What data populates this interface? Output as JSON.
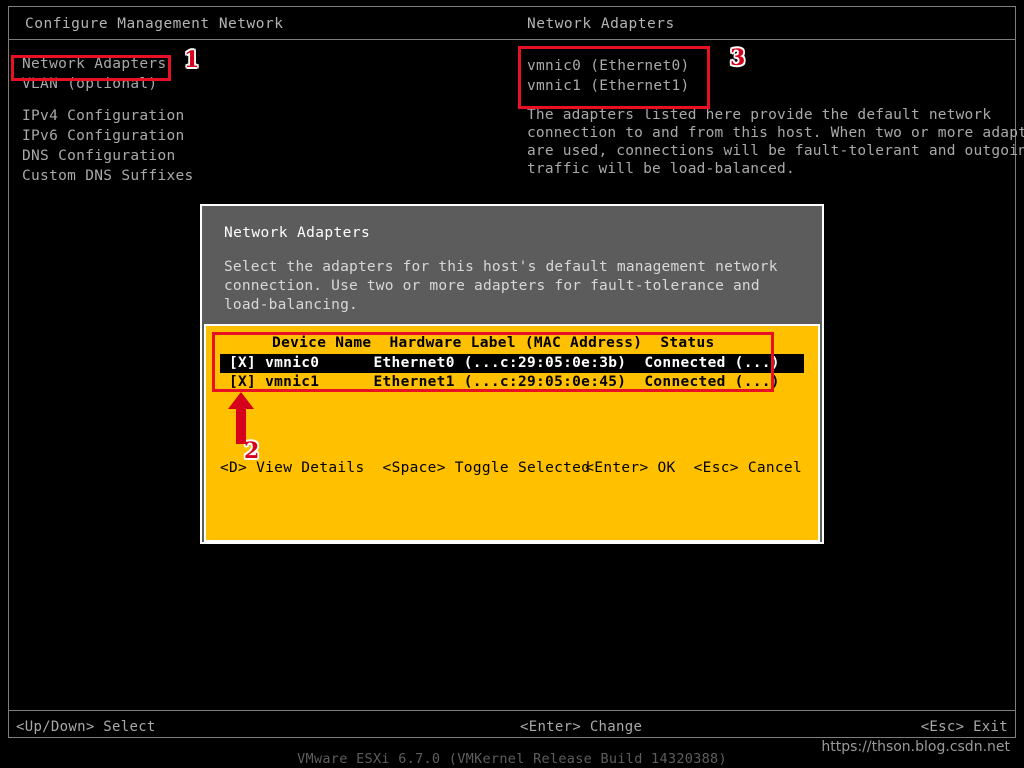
{
  "header": {
    "left_title": "Configure Management Network",
    "right_title": "Network Adapters"
  },
  "sidebar": {
    "items": [
      {
        "label": "Network Adapters"
      },
      {
        "label": "VLAN (optional)"
      },
      {
        "label": "IPv4 Configuration"
      },
      {
        "label": "IPv6 Configuration"
      },
      {
        "label": "DNS Configuration"
      },
      {
        "label": "Custom DNS Suffixes"
      }
    ]
  },
  "right_panel": {
    "adapters": [
      {
        "label": "vmnic0 (Ethernet0)"
      },
      {
        "label": "vmnic1 (Ethernet1)"
      }
    ],
    "description": [
      "The adapters listed here provide the default network",
      "connection to and from this host. When two or more adapters",
      "are used, connections will be fault-tolerant and outgoing",
      "traffic will be load-balanced."
    ]
  },
  "dialog": {
    "title": "Network Adapters",
    "description": [
      "Select the adapters for this host's default management network",
      "connection. Use two or more adapters for fault-tolerance and",
      "load-balancing."
    ],
    "table": {
      "headers": "  Device Name  Hardware Label (MAC Address)  Status",
      "rows": [
        {
          "checkbox": "[X]",
          "device_name": "vmnic0",
          "hardware_label": "Ethernet0 (...c:29:05:0e:3b)",
          "status": "Connected (...)",
          "line": "[X] vmnic0      Ethernet0 (...c:29:05:0e:3b)  Connected (...)",
          "selected": true
        },
        {
          "checkbox": "[X]",
          "device_name": "vmnic1",
          "hardware_label": "Ethernet1 (...c:29:05:0e:45)",
          "status": "Connected (...)",
          "line": "[X] vmnic1      Ethernet1 (...c:29:05:0e:45)  Connected (...)",
          "selected": false
        }
      ]
    },
    "footer_left": "<D> View Details  <Space> Toggle Selected",
    "footer_right": "<Enter> OK  <Esc> Cancel"
  },
  "status_bar": {
    "left": "<Up/Down> Select",
    "center": "<Enter> Change",
    "right": "<Esc> Exit"
  },
  "version": "VMware ESXi 6.7.0 (VMKernel Release Build 14320388)",
  "watermark": "https://thson.blog.csdn.net",
  "annotations": {
    "marker_1": "1",
    "marker_2": "2",
    "marker_3": "3"
  },
  "colors": {
    "background": "#000000",
    "selection_panel": "#ffc000",
    "dialog_body": "#5c5c5c",
    "annotation_red": "#e81123",
    "text": "#a9a9a9"
  }
}
